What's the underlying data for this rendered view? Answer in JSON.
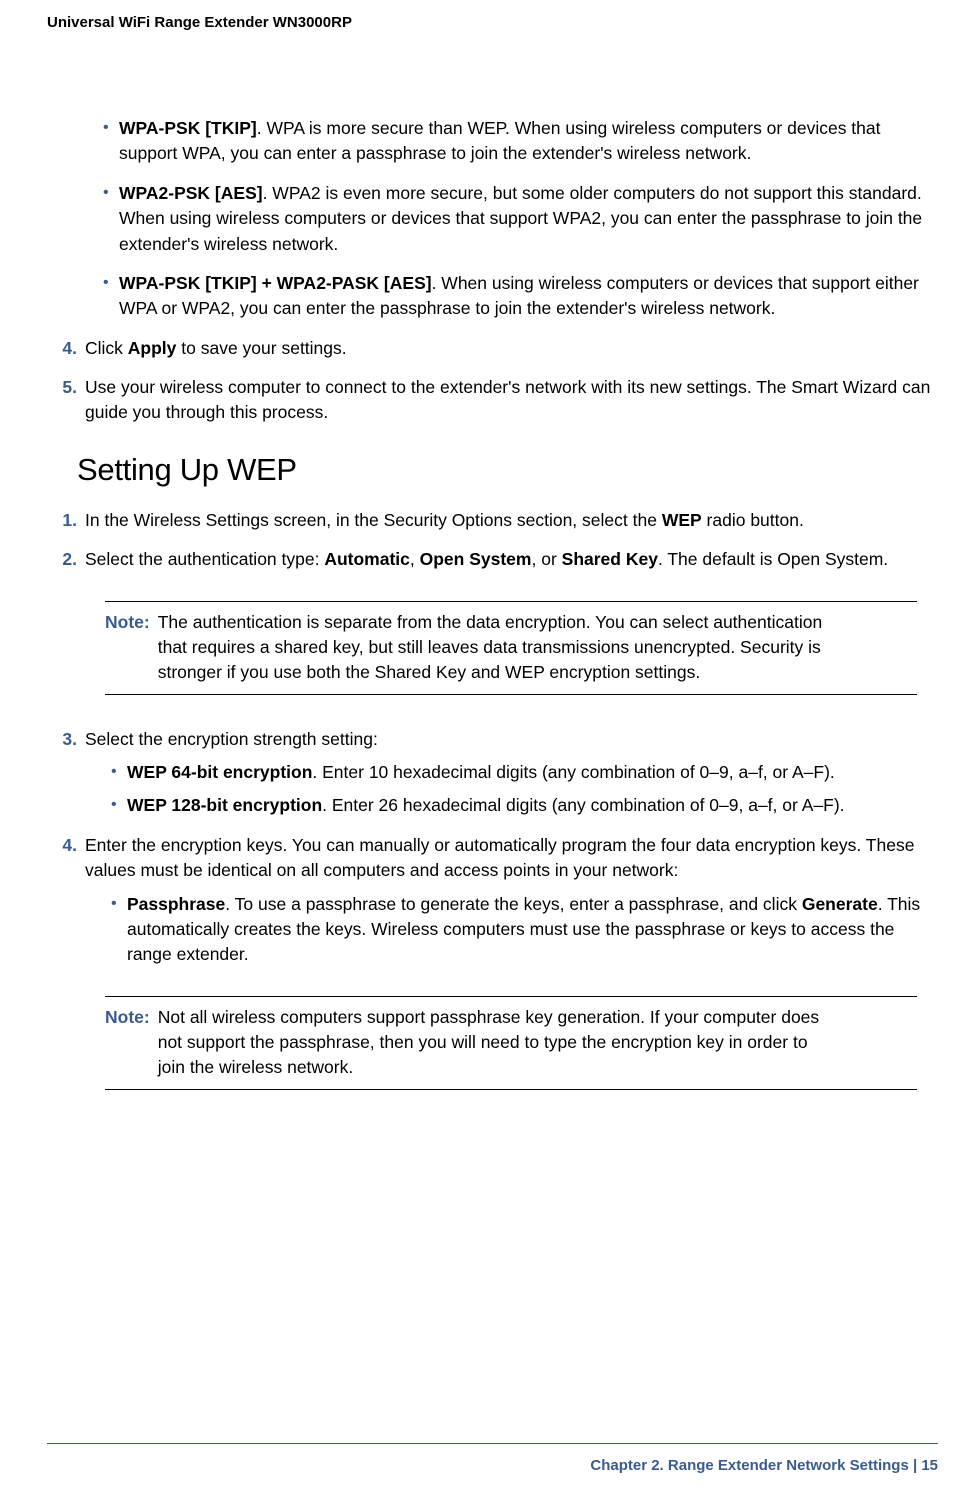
{
  "header": "Universal WiFi Range Extender WN3000RP",
  "topBullets": [
    {
      "lead": "WPA-PSK [TKIP]",
      "rest": ". WPA is more secure than WEP. When using wireless computers or devices that support WPA, you can enter a passphrase to join the extender's wireless network."
    },
    {
      "lead": " WPA2-PSK [AES]",
      "rest": ". WPA2 is even more secure, but some older computers do not support this standard. When using wireless computers or devices that support WPA2, you can enter the passphrase to join the extender's wireless network."
    },
    {
      "lead": "WPA-PSK [TKIP] + WPA2-PASK [AES]",
      "rest": ". When using wireless computers or devices that support either WPA or WPA2, you can enter the passphrase to join the extender's wireless network."
    }
  ],
  "step4": {
    "num": "4.",
    "pre": "Click ",
    "bold": "Apply",
    "post": " to save your settings."
  },
  "step5": {
    "num": "5.",
    "text": "Use your wireless computer to connect to the extender's network with its new settings. The Smart Wizard can guide you through this process."
  },
  "h2": "Setting Up WEP",
  "wep": {
    "step1": {
      "num": "1.",
      "pre": "In the Wireless Settings screen, in the Security Options section, select the ",
      "bold": "WEP",
      "post": " radio button."
    },
    "step2": {
      "num": "2.",
      "parts": [
        {
          "t": "Select the authentication type: "
        },
        {
          "t": "Automatic",
          "b": true
        },
        {
          "t": ", "
        },
        {
          "t": "Open System",
          "b": true
        },
        {
          "t": ", or "
        },
        {
          "t": "Shared Key",
          "b": true
        },
        {
          "t": ". The default is Open System."
        }
      ]
    },
    "note1": {
      "label": "Note:",
      "text": "The authentication is separate from the data encryption. You can select authentication that requires a shared key, but still leaves data transmissions unencrypted. Security is stronger if you use both the Shared Key and WEP encryption settings."
    },
    "step3": {
      "num": "3.",
      "text": "Select the encryption strength setting:",
      "subs": [
        {
          "lead": "WEP 64-bit encryption",
          "rest": ". Enter 10 hexadecimal digits (any combination of 0–9, a–f, or A–F)."
        },
        {
          "lead": "WEP 128-bit encryption",
          "rest": ". Enter 26 hexadecimal digits (any combination of 0–9, a–f, or A–F)."
        }
      ]
    },
    "step4b": {
      "num": "4.",
      "text": "Enter the encryption keys. You can manually or automatically program the four data encryption keys. These values must be identical on all computers and access points in your network:",
      "sub": {
        "lead": "Passphrase",
        "rest": ". To use a passphrase to generate the keys, enter a passphrase, and click ",
        "bold2": "Generate",
        "rest2": ". This automatically creates the keys. Wireless computers must use the passphrase or keys to access the range extender."
      }
    },
    "note2": {
      "label": "Note:",
      "text": "Not all wireless computers support passphrase key generation. If your computer does not support the passphrase, then you will need to type the encryption key in order to join the wireless network."
    }
  },
  "footer": {
    "chapter": "Chapter 2.  Range Extender Network Settings     |    ",
    "page": "15"
  }
}
